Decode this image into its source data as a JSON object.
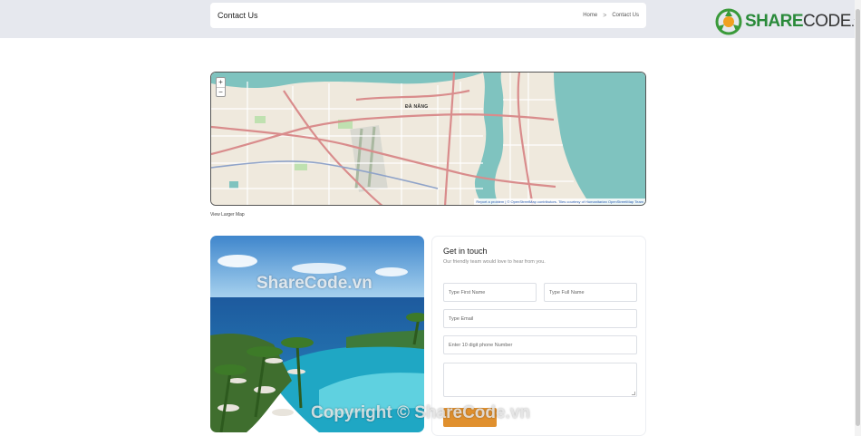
{
  "header": {
    "title": "Contact Us",
    "breadcrumb": [
      "Home",
      "Contact Us"
    ],
    "separator": ">"
  },
  "logo": {
    "brand_a": "SHARE",
    "brand_b": "CODE",
    "brand_c": ".vn"
  },
  "map": {
    "zoom_in": "+",
    "zoom_out": "−",
    "city_label": "ĐÀ NẴNG",
    "attribution_link": "Report a problem",
    "attribution_text": " | © OpenStreetMap contributors. Tiles courtesy of Humanitarian OpenStreetMap Team",
    "view_larger": "View Larger Map",
    "colors": {
      "sea": "#7fc3bf",
      "land": "#efe9dd",
      "major_road": "#d98c8c",
      "minor_road": "#ffffff"
    }
  },
  "form": {
    "title": "Get in touch",
    "subtitle": "Our friendly team would love to hear from you.",
    "first_name_placeholder": "Type First Name",
    "full_name_placeholder": "Type Full Name",
    "email_placeholder": "Type Email",
    "phone_placeholder": "Enter 10 digit phone Number",
    "message_placeholder": "",
    "submit_color": "#e0902e"
  },
  "watermarks": {
    "photo": "ShareCode.vn",
    "footer": "Copyright © ShareCode.vn"
  }
}
